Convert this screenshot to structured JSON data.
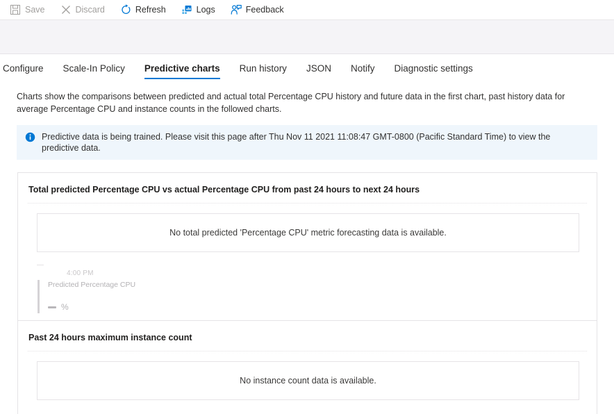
{
  "toolbar": {
    "items": [
      {
        "label": "Save",
        "icon": "save-icon",
        "enabled": false
      },
      {
        "label": "Discard",
        "icon": "discard-icon",
        "enabled": false
      },
      {
        "label": "Refresh",
        "icon": "refresh-icon",
        "enabled": true
      },
      {
        "label": "Logs",
        "icon": "logs-icon",
        "enabled": true
      },
      {
        "label": "Feedback",
        "icon": "feedback-icon",
        "enabled": true
      }
    ]
  },
  "tabs": {
    "items": [
      {
        "label": "Configure",
        "active": false
      },
      {
        "label": "Scale-In Policy",
        "active": false
      },
      {
        "label": "Predictive charts",
        "active": true
      },
      {
        "label": "Run history",
        "active": false
      },
      {
        "label": "JSON",
        "active": false
      },
      {
        "label": "Notify",
        "active": false
      },
      {
        "label": "Diagnostic settings",
        "active": false
      }
    ]
  },
  "description": "Charts show the comparisons between predicted and actual total Percentage CPU history and future data in the first chart, past history data for average Percentage CPU and instance counts in the followed charts.",
  "banner": {
    "icon": "info-icon",
    "text": "Predictive data is being trained. Please visit this page after Thu Nov 11 2021 11:08:47 GMT-0800 (Pacific Standard Time) to view the predictive data."
  },
  "cards": [
    {
      "title": "Total predicted Percentage CPU vs actual Percentage CPU from past 24 hours to next 24 hours",
      "no_data_message": "No total predicted 'Percentage CPU' metric forecasting data is available.",
      "ghost": {
        "x_tick": "4:00 PM",
        "legend_title": "Predicted Percentage CPU",
        "legend_unit": "%"
      }
    },
    {
      "title": "Past 24 hours maximum instance count",
      "no_data_message": "No instance count data is available."
    }
  ],
  "colors": {
    "accent": "#0078d4",
    "banner_bg": "#eff6fc",
    "band_bg": "#f5f4f7",
    "text": "#323130",
    "disabled_text": "#a19f9d"
  }
}
